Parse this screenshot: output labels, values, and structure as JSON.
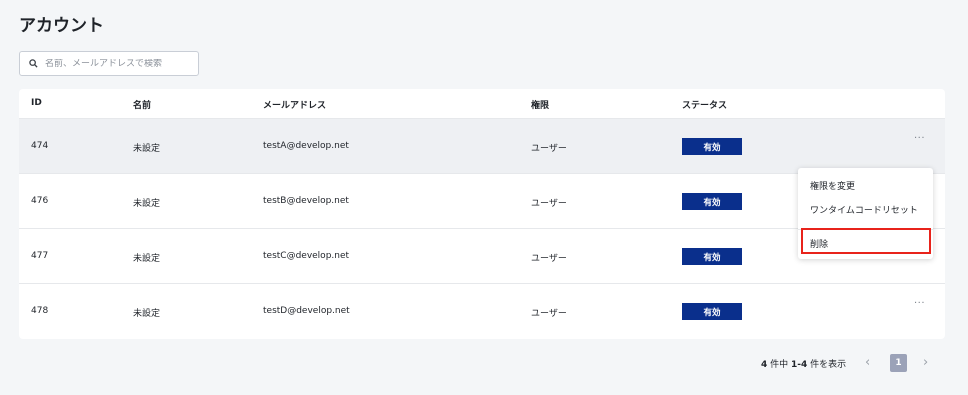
{
  "page": {
    "title": "アカウント"
  },
  "search": {
    "placeholder": "名前、メールアドレスで検索",
    "value": ""
  },
  "table": {
    "headers": {
      "id": "ID",
      "name": "名前",
      "email": "メールアドレス",
      "role": "権限",
      "status": "ステータス"
    },
    "rows": [
      {
        "id": "474",
        "name": "未設定",
        "email": "testA@develop.net",
        "role": "ユーザー",
        "status": "有効",
        "more": "···"
      },
      {
        "id": "476",
        "name": "未設定",
        "email": "testB@develop.net",
        "role": "ユーザー",
        "status": "有効"
      },
      {
        "id": "477",
        "name": "未設定",
        "email": "testC@develop.net",
        "role": "ユーザー",
        "status": "有効"
      },
      {
        "id": "478",
        "name": "未設定",
        "email": "testD@develop.net",
        "role": "ユーザー",
        "status": "有効",
        "more": "···"
      }
    ]
  },
  "menu": {
    "items": [
      "権限を変更",
      "ワンタイムコードリセット",
      "削除"
    ]
  },
  "pagination": {
    "count": "4",
    "count_suffix": " 件中 ",
    "range": "1-4",
    "range_suffix": " 件を表示",
    "prev": "‹",
    "current_page": "1",
    "next": "›"
  },
  "colors": {
    "status_badge": "#0a2f8c",
    "highlight": "#e8231b",
    "page_active": "#9ba2b8"
  },
  "icons": {
    "search": "search-icon",
    "more": "more-horizontal-icon",
    "prev": "chevron-left-icon",
    "next": "chevron-right-icon"
  }
}
